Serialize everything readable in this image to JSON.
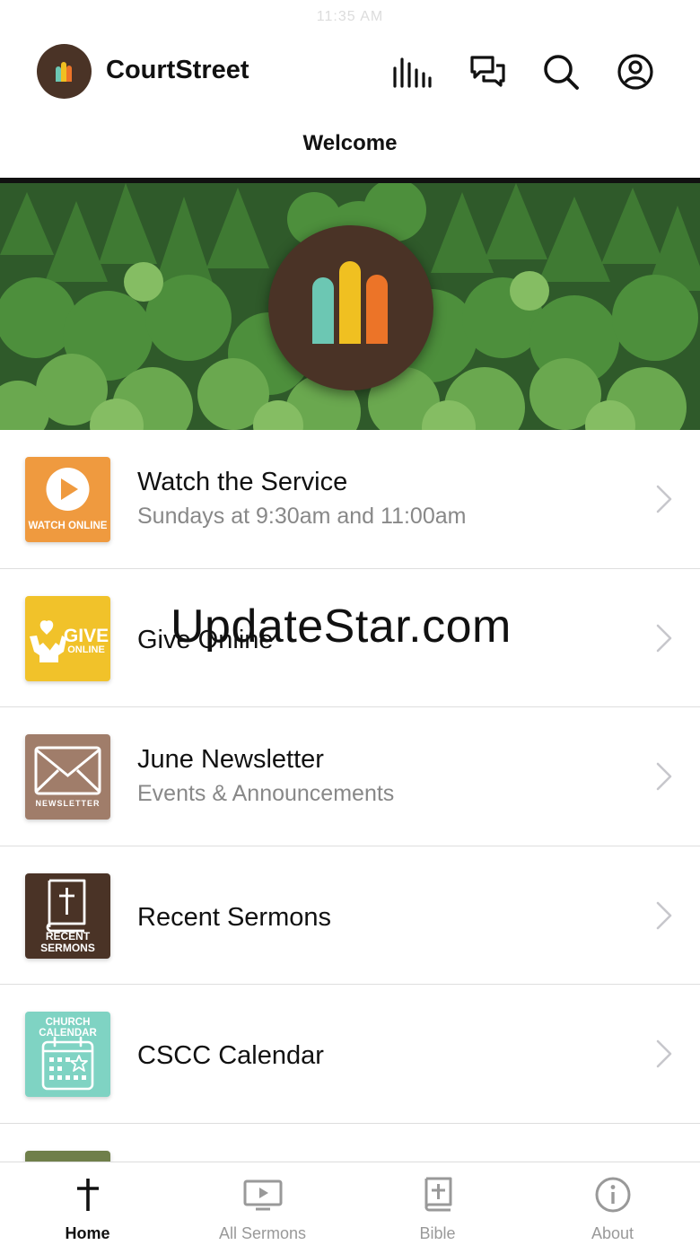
{
  "status_bar": {
    "time": "11:35 AM"
  },
  "header": {
    "app_name": "CourtStreet",
    "actions": [
      "stats-icon",
      "chat-icon",
      "search-icon",
      "account-icon"
    ]
  },
  "page": {
    "title": "Welcome"
  },
  "colors": {
    "brand_brown": "#4a3326",
    "logo_teal": "#6cc7b3",
    "logo_yellow": "#f0c021",
    "logo_orange": "#ec7428",
    "watch_tile": "#ef9a3f",
    "give_tile": "#f1c22a",
    "newsletter_tile": "#a07d6a",
    "sermons_tile": "#4a3326",
    "calendar_tile": "#7fd3c3"
  },
  "menu": {
    "items": [
      {
        "title": "Watch the Service",
        "subtitle": "Sundays at 9:30am and 11:00am",
        "tile_text": "WATCH ONLINE",
        "icon": "play-icon"
      },
      {
        "title": "Give Online",
        "subtitle": "",
        "tile_text_1": "GIVE",
        "tile_text_2": "ONLINE",
        "icon": "giving-hands-icon"
      },
      {
        "title": "June Newsletter",
        "subtitle": "Events & Announcements",
        "tile_text": "NEWSLETTER",
        "icon": "envelope-icon"
      },
      {
        "title": "Recent Sermons",
        "subtitle": "",
        "tile_text_1": "RECENT",
        "tile_text_2": "SERMONS",
        "icon": "bible-icon"
      },
      {
        "title": "CSCC Calendar",
        "subtitle": "",
        "tile_text_1": "CHURCH",
        "tile_text_2": "CALENDAR",
        "icon": "calendar-icon"
      }
    ]
  },
  "watermark": "UpdateStar.com",
  "tabbar": {
    "active": "Home",
    "tabs": [
      {
        "label": "Home",
        "icon": "cross-icon"
      },
      {
        "label": "All Sermons",
        "icon": "video-icon"
      },
      {
        "label": "Bible",
        "icon": "bible-plus-icon"
      },
      {
        "label": "About",
        "icon": "info-icon"
      }
    ]
  }
}
